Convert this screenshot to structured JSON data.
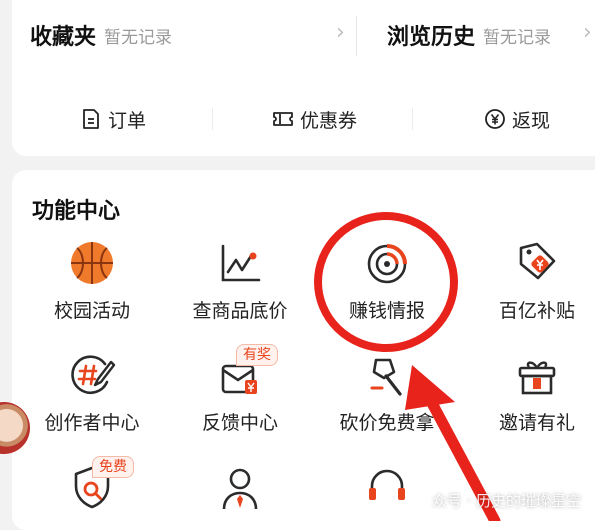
{
  "favorites": {
    "title": "收藏夹",
    "status": "暂无记录"
  },
  "history": {
    "title": "浏览历史",
    "status": "暂无记录"
  },
  "quick_links": [
    {
      "label": "订单",
      "icon": "order-document-icon"
    },
    {
      "label": "优惠券",
      "icon": "coupon-icon"
    },
    {
      "label": "返现",
      "icon": "yen-cashback-icon"
    }
  ],
  "function_center": {
    "title": "功能中心",
    "items": [
      {
        "label": "校园活动",
        "icon": "basketball-icon"
      },
      {
        "label": "查商品底价",
        "icon": "price-chart-icon"
      },
      {
        "label": "赚钱情报",
        "icon": "radar-icon"
      },
      {
        "label": "百亿补贴",
        "icon": "price-tag-icon"
      },
      {
        "label": "创作者中心",
        "icon": "hashtag-pen-icon"
      },
      {
        "label": "反馈中心",
        "icon": "feedback-icon",
        "badge": "有奖"
      },
      {
        "label": "砍价免费拿",
        "icon": "axe-icon"
      },
      {
        "label": "邀请有礼",
        "icon": "gift-icon"
      },
      {
        "label": "",
        "icon": "shield-search-icon",
        "badge": "免费"
      },
      {
        "label": "",
        "icon": "person-tie-icon"
      },
      {
        "label": "",
        "icon": "headset-icon"
      }
    ]
  },
  "watermark": "众号 · 历史的璀璨星空",
  "colors": {
    "accent": "#e8451e",
    "annotation": "#e8231b",
    "icon_dark": "#2b2b2b"
  }
}
